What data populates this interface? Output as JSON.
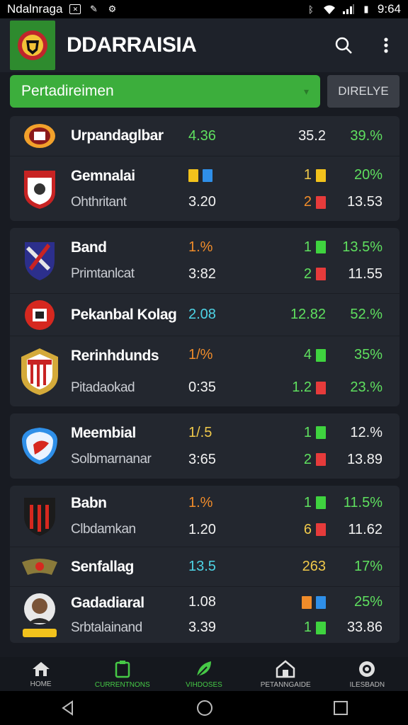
{
  "status_bar": {
    "carrier": "Ndalnraga",
    "time": "9:64"
  },
  "app_bar": {
    "title": "DDARRAISIA",
    "logo_color": "#2e8b2e",
    "icons": [
      "search-icon",
      "more-vert-icon"
    ]
  },
  "filter": {
    "competition": "Pertadireimen",
    "button_label": "DIRELYE"
  },
  "groups": [
    {
      "rows": [
        {
          "team": "Urpandaglbar",
          "sub": "",
          "a1": "4.36",
          "b1": "35.2",
          "c1": "39.%"
        },
        {
          "team": "Gemnalai",
          "sub": "Ohthritant",
          "a2": "3.20",
          "b1": "1",
          "b2": "2",
          "c1": "20%",
          "c2": "13.53"
        }
      ]
    },
    {
      "rows": [
        {
          "team": "Band",
          "sub": "Primtanlcat",
          "a1": "1.%",
          "a2": "3:82",
          "b1": "1",
          "b2": "2",
          "c1": "13.5%",
          "c2": "11.55"
        },
        {
          "team": "Pekanbal Kolag",
          "sub": "",
          "a1": "2.08",
          "b1": "12.82",
          "c1": "52.%"
        },
        {
          "team": "Rerinhdunds",
          "sub": "Pitadaokad",
          "a1": "1/%",
          "a2": "0:35",
          "b1": "4",
          "b2": "1.2",
          "c1": "35%",
          "c2": "23.%"
        }
      ]
    },
    {
      "rows": [
        {
          "team": "Meembial",
          "sub": "Solbmarnanar",
          "a1": "1/.5",
          "a2": "3:65",
          "b1": "1",
          "b2": "2",
          "c1": "12.%",
          "c2": "13.89"
        }
      ]
    },
    {
      "rows": [
        {
          "team": "Babn",
          "sub": "Clbdamkan",
          "a1": "1.%",
          "a2": "1.20",
          "b1": "1",
          "b2": "6",
          "c1": "11.5%",
          "c2": "11.62"
        },
        {
          "team": "Senfallag",
          "sub": "",
          "a1": "13.5",
          "b1": "263",
          "c1": "17%"
        },
        {
          "team": "Gadadiaral",
          "sub": "Srbtalainand",
          "a1": "1.08",
          "a2": "3.39",
          "b2": "1",
          "c1": "25%",
          "c2": "33.86"
        }
      ]
    }
  ],
  "bottom_nav": [
    {
      "label": "HOME",
      "icon": "home-icon"
    },
    {
      "label": "CURRENTNONS",
      "icon": "clipboard-icon"
    },
    {
      "label": "VIHDOSES",
      "icon": "leaf-icon"
    },
    {
      "label": "PETANNGAIDE",
      "icon": "house-icon"
    },
    {
      "label": "ILESBADN",
      "icon": "target-icon"
    }
  ],
  "colors": {
    "accent_green": "#3cae3c",
    "background": "#181b22",
    "card": "#23272f"
  }
}
